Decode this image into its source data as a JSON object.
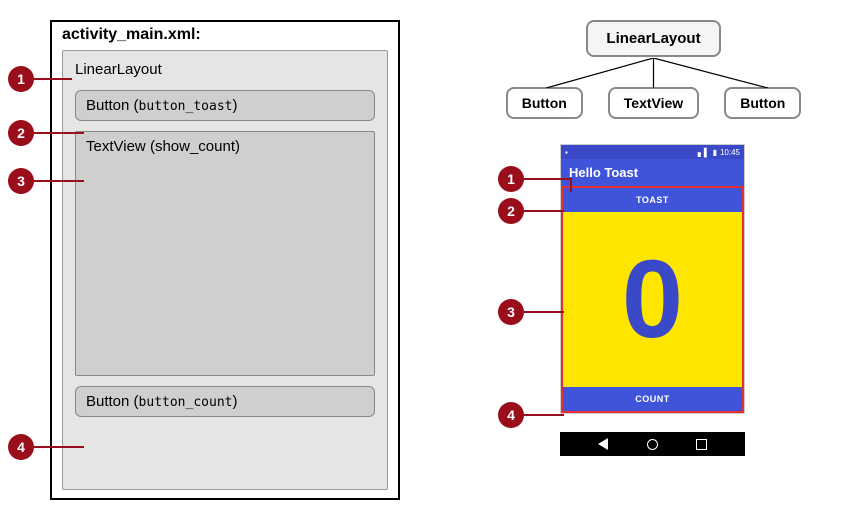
{
  "left": {
    "file_title": "activity_main.xml:",
    "root_label": "LinearLayout",
    "button1_label": "Button",
    "button1_id": "button_toast",
    "textview_label": "TextView",
    "textview_id": "show_count",
    "button2_label": "Button",
    "button2_id": "button_count"
  },
  "badges": {
    "b1": "1",
    "b2": "2",
    "b3": "3",
    "b4": "4"
  },
  "tree": {
    "root": "LinearLayout",
    "children": [
      "Button",
      "TextView",
      "Button"
    ]
  },
  "phone": {
    "time": "10:45",
    "app_title": "Hello Toast",
    "toast_btn": "TOAST",
    "count_value": "0",
    "count_btn": "COUNT"
  }
}
